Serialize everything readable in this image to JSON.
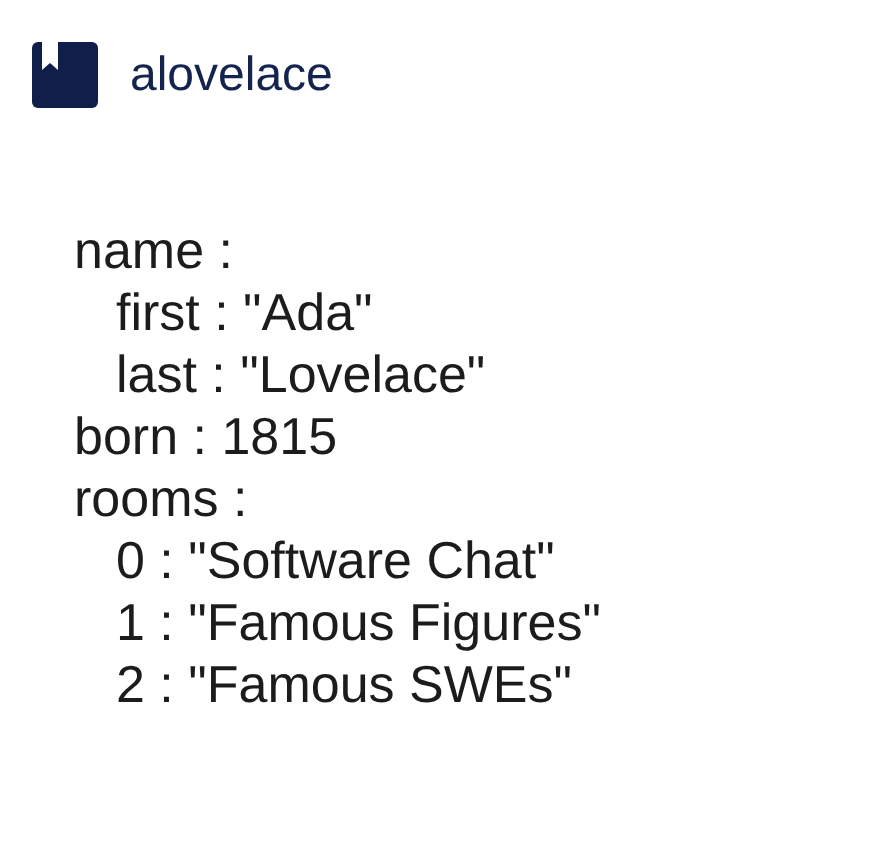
{
  "header": {
    "title": "alovelace"
  },
  "tree": [
    {
      "text": "name :",
      "children": [
        {
          "text": "first : \"Ada\""
        },
        {
          "text": "last : \"Lovelace\""
        }
      ]
    },
    {
      "text": "born : 1815"
    },
    {
      "text": "rooms :",
      "children": [
        {
          "text": "0 : \"Software Chat\""
        },
        {
          "text": "1 : \"Famous Figures\""
        },
        {
          "text": "2 : \"Famous SWEs\""
        }
      ]
    }
  ]
}
